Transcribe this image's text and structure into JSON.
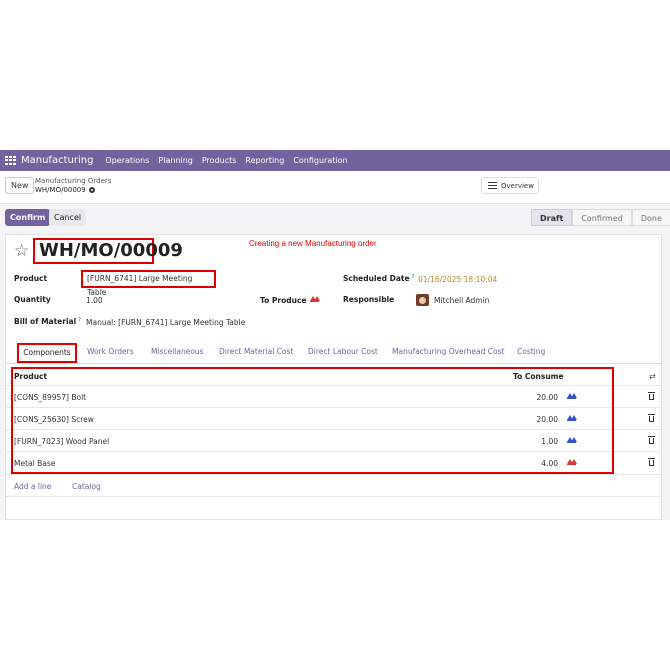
{
  "navbar": {
    "brand": "Manufacturing",
    "menu": [
      "Operations",
      "Planning",
      "Products",
      "Reporting",
      "Configuration"
    ]
  },
  "control": {
    "new_label": "New",
    "breadcrumb_parent": "Manufacturing Orders",
    "breadcrumb_current": "WH/MO/00009",
    "overview_label": "Overview"
  },
  "actions": {
    "confirm_label": "Confirm",
    "cancel_label": "Cancel"
  },
  "status": {
    "stages": [
      "Draft",
      "Confirmed",
      "Done"
    ],
    "active": "Draft"
  },
  "record": {
    "name": "WH/MO/00009",
    "annotation": "Creating a new Manufacturing order",
    "product_label": "Product",
    "product": "[FURN_6741] Large Meeting Table",
    "quantity_label": "Quantity",
    "quantity": "1.00",
    "to_produce_label": "To Produce",
    "bom_label": "Bill of Material",
    "bom_help": "?",
    "bom": "Manual: [FURN_6741] Large Meeting Table",
    "scheduled_label": "Scheduled Date",
    "scheduled_help": "?",
    "scheduled_date": "01/16/2025 18:10:04",
    "responsible_label": "Responsible",
    "responsible": "Mitchell Admin"
  },
  "tabs": [
    "Components",
    "Work Orders",
    "Miscellaneous",
    "Direct Material Cost",
    "Direct Labour Cost",
    "Manufacturing Overhead Cost",
    "Costing"
  ],
  "components": {
    "headers": {
      "product": "Product",
      "to_consume": "To Consume"
    },
    "rows": [
      {
        "product": "[CONS_89957] Bolt",
        "qty": "20.00",
        "forecast": "available"
      },
      {
        "product": "[CONS_25630] Screw",
        "qty": "20.00",
        "forecast": "available"
      },
      {
        "product": "[FURN_7023] Wood Panel",
        "qty": "1.00",
        "forecast": "available"
      },
      {
        "product": "Metal Base",
        "qty": "4.00",
        "forecast": "unavailable"
      }
    ],
    "add_line": "Add a line",
    "catalog": "Catalog"
  },
  "colors": {
    "brand": "#71639e",
    "highlight": "#e00000",
    "available": "#3355cc",
    "unavailable": "#dd3333",
    "date": "#b5892e"
  }
}
